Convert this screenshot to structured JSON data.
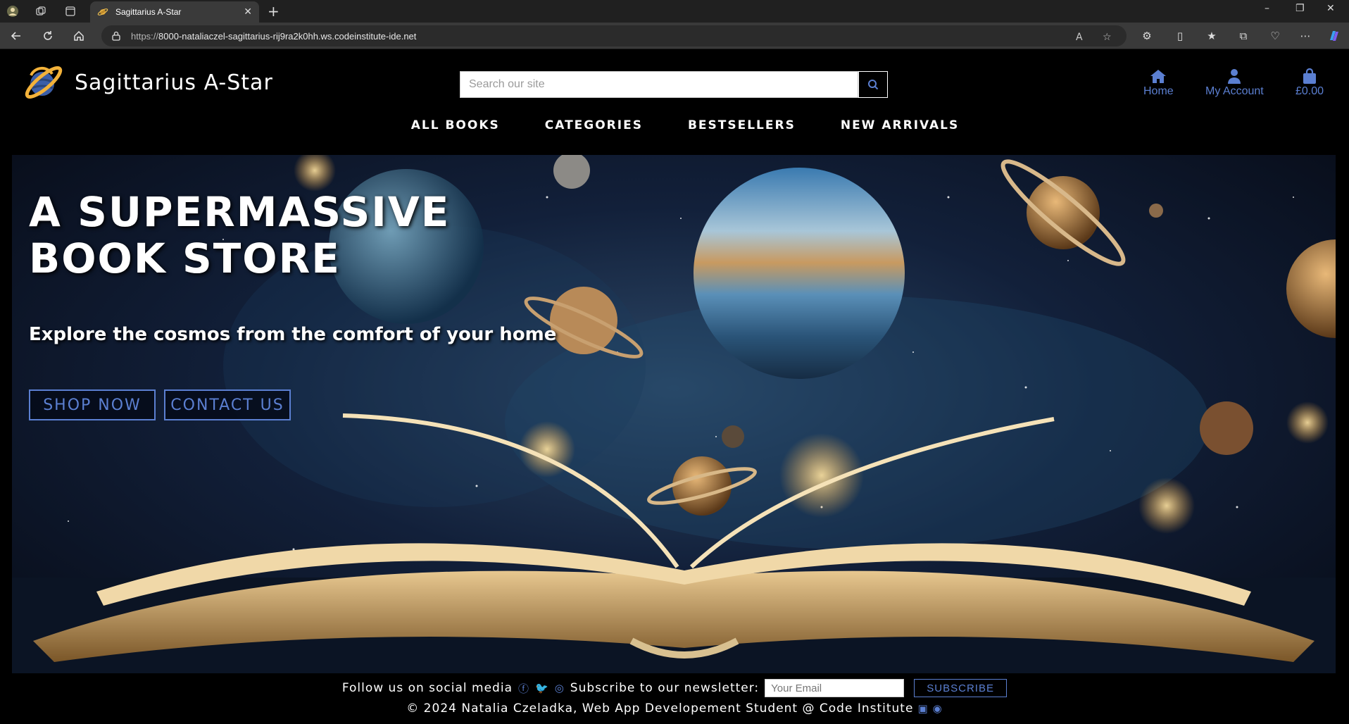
{
  "browser": {
    "tab_title": "Sagittarius A-Star",
    "url_scheme": "https://",
    "url_rest": "8000-nataliaczel-sagittarius-rij9ra2k0hh.ws.codeinstitute-ide.net",
    "new_tab_label": "+",
    "close_label": "✕",
    "read_aloud_label": "A",
    "window": {
      "minimize": "–",
      "restore": "❐",
      "close": "✕"
    }
  },
  "site": {
    "brand": "Sagittarius A-Star",
    "search_placeholder": "Search our site",
    "accounts": [
      {
        "label": "Home"
      },
      {
        "label": "My Account"
      },
      {
        "label": "£0.00"
      }
    ],
    "nav": [
      "ALL BOOKS",
      "CATEGORIES",
      "BESTSELLERS",
      "NEW ARRIVALS"
    ]
  },
  "hero": {
    "title": "A SUPERMASSIVE BOOK STORE",
    "subtitle": "Explore the cosmos from the comfort of your home",
    "shop_now": "SHOP NOW",
    "contact_us": "CONTACT US"
  },
  "footer": {
    "follow_text": "Follow us on social media",
    "subscribe_text": "Subscribe to our newsletter:",
    "email_placeholder": "Your Email",
    "subscribe_button": "SUBSCRIBE",
    "copyright": "© 2024 Natalia Czeladka, Web App Developement Student @ Code Institute"
  },
  "colors": {
    "accent": "#5b7fd1",
    "background": "#000000",
    "chrome": "#202020",
    "toolbar": "#3a3a3a"
  },
  "icons": [
    "facebook-icon",
    "twitter-icon",
    "instagram-icon",
    "linkedin-icon",
    "github-icon",
    "home-icon",
    "user-icon",
    "shopping-bag-icon",
    "search-icon"
  ]
}
